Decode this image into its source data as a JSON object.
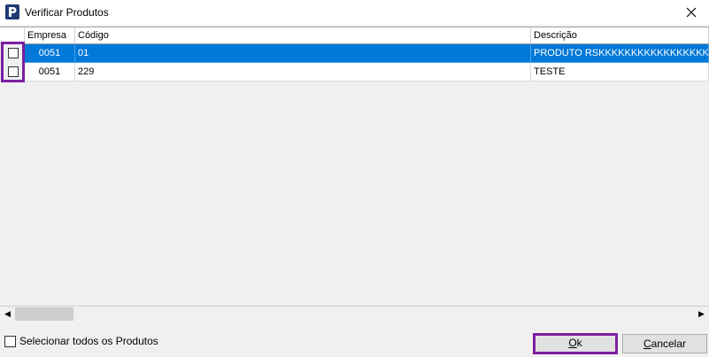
{
  "window": {
    "title": "Verificar Produtos"
  },
  "grid": {
    "columns": [
      "Empresa",
      "Código",
      "Descrição"
    ],
    "rows": [
      {
        "empresa": "0051",
        "codigo": "01",
        "descricao": "PRODUTO RSKKKKKKKKKKKKKKKKKKKKKKKKKKKKKKKKK",
        "selected": true
      },
      {
        "empresa": "0051",
        "codigo": "229",
        "descricao": "TESTE",
        "selected": false
      }
    ]
  },
  "footer": {
    "select_all_label": "Selecionar todos os Produtos",
    "ok_label": "Ok",
    "cancel_label": "Cancelar"
  },
  "colors": {
    "selection": "#0078d7",
    "highlight": "#7b1fa2"
  }
}
